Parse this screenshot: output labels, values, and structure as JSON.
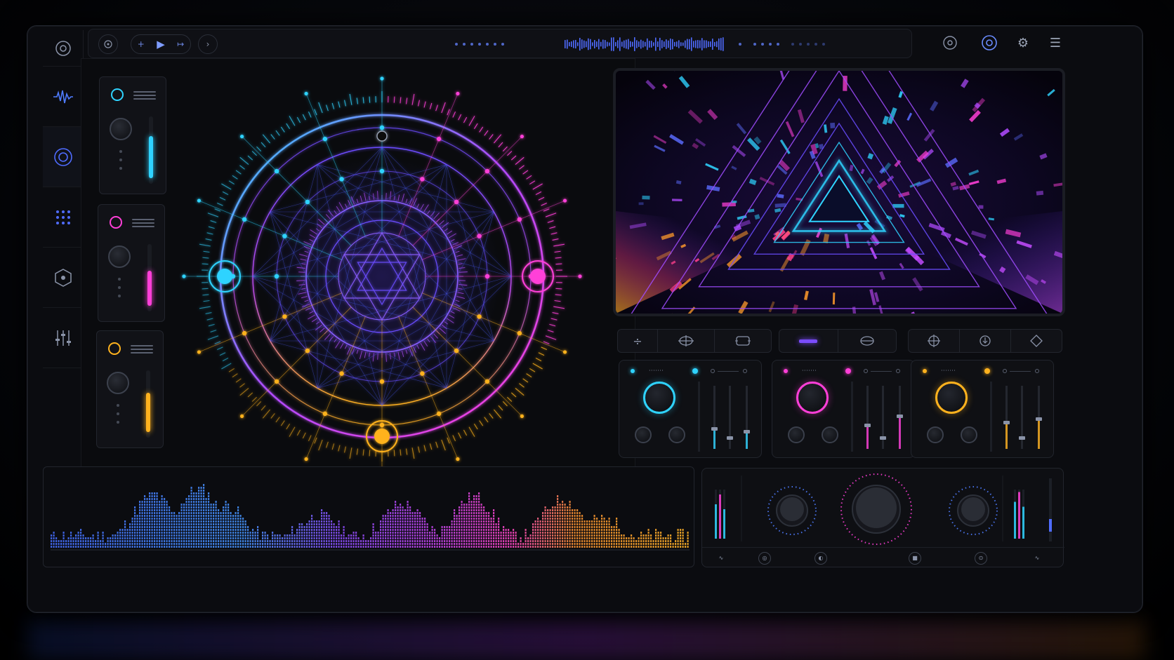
{
  "app": {
    "accent_blue": "#2fd3ff",
    "accent_magenta": "#ff3fd8",
    "accent_orange": "#ffb21e",
    "accent_violet": "#8a5cff"
  },
  "rail": {
    "items": [
      {
        "name": "logo-icon",
        "icon": "circle-target"
      },
      {
        "name": "waveform-icon",
        "icon": "waveform"
      },
      {
        "name": "target-icon",
        "icon": "concentric-circles"
      },
      {
        "name": "grid-icon",
        "icon": "dot-grid"
      },
      {
        "name": "hexagon-icon",
        "icon": "hexagon"
      },
      {
        "name": "sliders-icon",
        "icon": "sliders"
      }
    ]
  },
  "topbar": {
    "icons": [
      "back-icon",
      "play-icon",
      "forward-icon",
      "next-icon",
      "settings-icon",
      "menu-icon"
    ]
  },
  "strips": [
    {
      "color": "#2fd3ff",
      "level": 0.62
    },
    {
      "color": "#ff3fd8",
      "level": 0.55
    },
    {
      "color": "#ffb21e",
      "level": 0.6
    }
  ],
  "decks": [
    {
      "label": "·······",
      "color": "#2fd3ff",
      "faders": [
        0.35,
        0.2,
        0.3
      ]
    },
    {
      "label": "·······",
      "color": "#ff3fd8",
      "faders": [
        0.4,
        0.2,
        0.55
      ]
    },
    {
      "label": "·······",
      "color": "#ffb21e",
      "faders": [
        0.45,
        0.2,
        0.5
      ]
    }
  ],
  "toolbar": {
    "groups": [
      [
        "plus-minus-icon",
        "crosshair-icon",
        "frame-icon"
      ],
      [
        "bar-icon",
        "ellipse-icon"
      ],
      [
        "compass-icon",
        "download-icon",
        "diamond-icon"
      ]
    ]
  },
  "mixer": {
    "knobs": [
      "eq-low-knob",
      "master-knob",
      "eq-high-knob"
    ],
    "meter_left": [
      0.7,
      0.9,
      0.6
    ],
    "meter_right": [
      0.75,
      0.95,
      0.65
    ],
    "footer_icons": [
      "pulse-icon",
      "loop-icon",
      "sync-icon",
      "record-icon",
      "cue-icon",
      "pulse-icon"
    ]
  }
}
